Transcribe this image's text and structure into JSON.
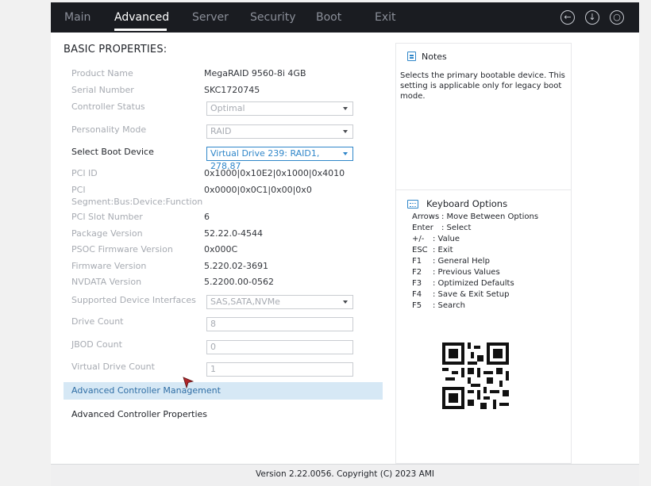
{
  "nav": {
    "tabs": [
      {
        "label": "Main"
      },
      {
        "label": "Advanced"
      },
      {
        "label": "Server"
      },
      {
        "label": "Security"
      },
      {
        "label": "Boot"
      },
      {
        "label": "Exit"
      }
    ],
    "active_tab": "Advanced",
    "icons": [
      "back-icon",
      "download-icon",
      "search-icon"
    ]
  },
  "section": {
    "title": "BASIC PROPERTIES:"
  },
  "rows": {
    "product_name": {
      "label": "Product Name",
      "value": "MegaRAID 9560-8i 4GB"
    },
    "serial_number": {
      "label": "Serial Number",
      "value": "SKC1720745"
    },
    "controller_status": {
      "label": "Controller Status",
      "value": "Optimal"
    },
    "personality_mode": {
      "label": "Personality Mode",
      "value": "RAID"
    },
    "select_boot_device": {
      "label": "Select Boot Device",
      "value": "Virtual Drive 239: RAID1, 278.87"
    },
    "pci_id": {
      "label": "PCI ID",
      "value": "0x1000|0x10E2|0x1000|0x4010"
    },
    "pci_segment": {
      "label_line1": "PCI",
      "label_line2": "Segment:Bus:Device:Function",
      "value": "0x0000|0x0C1|0x00|0x0"
    },
    "pci_slot_number": {
      "label": "PCI Slot Number",
      "value": "6"
    },
    "package_version": {
      "label": "Package Version",
      "value": "52.22.0-4544"
    },
    "psoc_firmware_version": {
      "label": "PSOC Firmware Version",
      "value": "0x000C"
    },
    "firmware_version": {
      "label": "Firmware Version",
      "value": "5.220.02-3691"
    },
    "nvdata_version": {
      "label": "NVDATA Version",
      "value": "5.2200.00-0562"
    },
    "supported_device_interfaces": {
      "label": "Supported Device Interfaces",
      "value": "SAS,SATA,NVMe"
    },
    "drive_count": {
      "label": "Drive Count",
      "value": "8"
    },
    "jbod_count": {
      "label": "JBOD Count",
      "value": "0"
    },
    "virtual_drive_count": {
      "label": "Virtual Drive Count",
      "value": "1"
    }
  },
  "links": {
    "advanced_controller_management": "Advanced Controller Management",
    "advanced_controller_properties": "Advanced Controller Properties"
  },
  "notes": {
    "title": "Notes",
    "text": "Selects the primary bootable device. This setting is applicable only for legacy boot mode."
  },
  "keyboard": {
    "title": "Keyboard Options",
    "items": [
      {
        "key": "Arrows",
        "desc": ": Move Between Options"
      },
      {
        "key": "Enter",
        "desc": ": Select"
      },
      {
        "key": "+/-",
        "desc": ": Value"
      },
      {
        "key": "ESC",
        "desc": ": Exit"
      },
      {
        "key": "F1",
        "desc": ": General Help"
      },
      {
        "key": "F2",
        "desc": ": Previous Values"
      },
      {
        "key": "F3",
        "desc": ": Optimized Defaults"
      },
      {
        "key": "F4",
        "desc": ": Save & Exit Setup"
      },
      {
        "key": "F5",
        "desc": ": Search"
      }
    ]
  },
  "footer": {
    "text": "Version 2.22.0056. Copyright (C) 2023 AMI"
  },
  "colors": {
    "accent": "#2f86c9",
    "nav_bg": "#1a1c21",
    "link_highlight": "#d6e8f5"
  }
}
